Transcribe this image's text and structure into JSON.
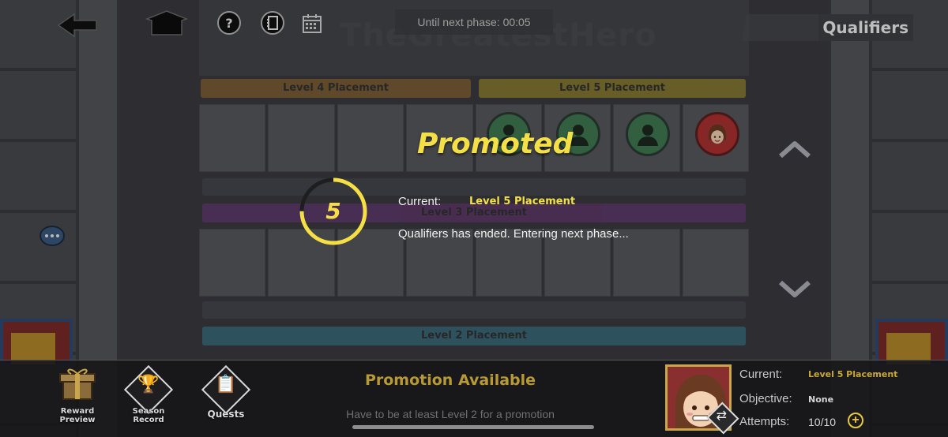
{
  "header": {
    "phase_timer": "Until next phase: 00:05",
    "mode": "Qualifiers",
    "ghost_title": "TheGreatestHero"
  },
  "icons": {
    "back": "back-arrow-icon",
    "home": "home-icon",
    "help": "help-icon",
    "notebook": "notebook-icon",
    "calendar": "calendar-icon",
    "chat": "chat-icon",
    "scroll_up": "chevron-up-icon",
    "scroll_down": "chevron-down-icon"
  },
  "placements": {
    "level4": "Level 4 Placement",
    "level5": "Level 5 Placement",
    "level3": "Level 3 Placement",
    "level2": "Level 2 Placement"
  },
  "overlay": {
    "title": "Promoted",
    "countdown": "5",
    "countdown_fraction": 0.75,
    "current_label": "Current:",
    "current_value": "Level 5 Placement",
    "message": "Qualifiers has ended. Entering next phase..."
  },
  "bottom": {
    "reward_preview": "Reward Preview",
    "season_record": "Season Record",
    "quests": "Quests",
    "promotion_title": "Promotion Available",
    "promotion_sub": "Have to be at least Level 2 for a promotion"
  },
  "player": {
    "current_label": "Current:",
    "current_value": "Level 5 Placement",
    "objective_label": "Objective:",
    "objective_value": "None",
    "attempts_label": "Attempts:",
    "attempts_value": "10/10"
  },
  "colors": {
    "accent_yellow": "#f4e046",
    "level4": "#b07a2f",
    "level5": "#c3aa2a",
    "level3": "#7a3a8a",
    "level2": "#3a8ea6"
  }
}
